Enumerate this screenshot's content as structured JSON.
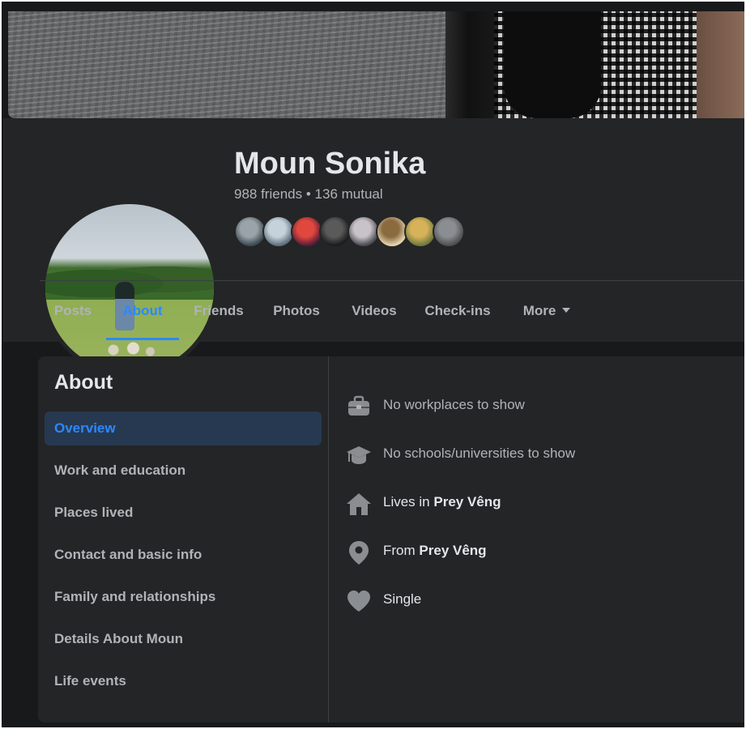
{
  "profile": {
    "name": "Moun Sonika",
    "friends_count": "988 friends",
    "separator": "•",
    "mutual": "136 mutual"
  },
  "friend_avatars": [
    {
      "color_a": "#3c4a52",
      "color_b": "#9aa3a8"
    },
    {
      "color_a": "#5d6f7d",
      "color_b": "#c6d2da"
    },
    {
      "color_a": "#5a1d3a",
      "color_b": "#e0483d"
    },
    {
      "color_a": "#1c1c1c",
      "color_b": "#5a5a5a"
    },
    {
      "color_a": "#4b4b52",
      "color_b": "#c9c3c8"
    },
    {
      "color_a": "#e6d4b4",
      "color_b": "#8a6b3f"
    },
    {
      "color_a": "#6e7a3d",
      "color_b": "#d6b25a"
    },
    {
      "color_a": "#4e4f50",
      "color_b": "#8a8d91"
    }
  ],
  "tabs": [
    {
      "label": "Posts"
    },
    {
      "label": "About"
    },
    {
      "label": "Friends"
    },
    {
      "label": "Photos"
    },
    {
      "label": "Videos"
    },
    {
      "label": "Check-ins"
    },
    {
      "label": "More"
    }
  ],
  "about": {
    "title": "About",
    "nav": [
      {
        "label": "Overview"
      },
      {
        "label": "Work and education"
      },
      {
        "label": "Places lived"
      },
      {
        "label": "Contact and basic info"
      },
      {
        "label": "Family and relationships"
      },
      {
        "label": "Details About Moun"
      },
      {
        "label": "Life events"
      }
    ],
    "overview": {
      "work": {
        "icon": "briefcase-icon",
        "text": "No workplaces to show"
      },
      "school": {
        "icon": "graduation-cap-icon",
        "text": "No schools/universities to show"
      },
      "lives": {
        "icon": "home-icon",
        "prefix": "Lives in",
        "place": "Prey Vêng"
      },
      "from": {
        "icon": "location-pin-icon",
        "prefix": "From",
        "place": "Prey Vêng"
      },
      "relationship": {
        "icon": "heart-icon",
        "text": "Single"
      }
    }
  },
  "colors": {
    "background": "#18191a",
    "card": "#242526",
    "accent": "#2d88ff",
    "active_bg": "#263951",
    "text_primary": "#e4e6eb",
    "text_secondary": "#b0b3b8"
  }
}
